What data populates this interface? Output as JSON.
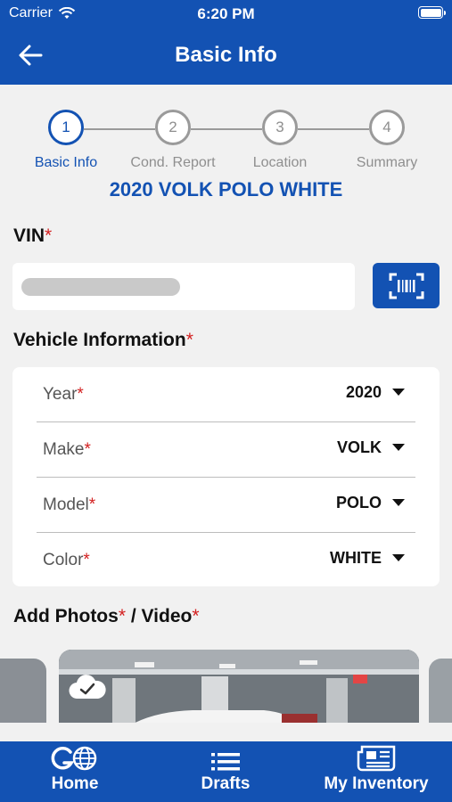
{
  "status_bar": {
    "carrier": "Carrier",
    "time": "6:20 PM"
  },
  "header": {
    "title": "Basic Info",
    "back_icon": "arrow-left-icon"
  },
  "stepper": {
    "active_index": 0,
    "steps": [
      {
        "number": "1",
        "label": "Basic Info"
      },
      {
        "number": "2",
        "label": "Cond. Report"
      },
      {
        "number": "3",
        "label": "Location"
      },
      {
        "number": "4",
        "label": "Summary"
      }
    ]
  },
  "vehicle_title": "2020 VOLK POLO WHITE",
  "vin": {
    "label": "VIN",
    "required_mark": "*",
    "scan_icon": "barcode-scan-icon"
  },
  "vehicle_info": {
    "label": "Vehicle Information",
    "required_mark": "*",
    "rows": [
      {
        "label": "Year",
        "required_mark": "*",
        "value": "2020"
      },
      {
        "label": "Make",
        "required_mark": "*",
        "value": "VOLK"
      },
      {
        "label": "Model",
        "required_mark": "*",
        "value": "POLO"
      },
      {
        "label": "Color",
        "required_mark": "*",
        "value": "WHITE"
      }
    ]
  },
  "media": {
    "label_photos": "Add Photos",
    "separator": " / ",
    "label_video": "Video",
    "required_mark": "*",
    "upload_icon": "cloud-check-icon"
  },
  "tab_bar": {
    "tabs": [
      {
        "label": "Home",
        "icon": "go-globe-icon"
      },
      {
        "label": "Drafts",
        "icon": "list-icon"
      },
      {
        "label": "My Inventory",
        "icon": "newspaper-icon"
      }
    ]
  },
  "colors": {
    "primary": "#1352b3",
    "required": "#d32020",
    "background": "#f1f1f1"
  }
}
